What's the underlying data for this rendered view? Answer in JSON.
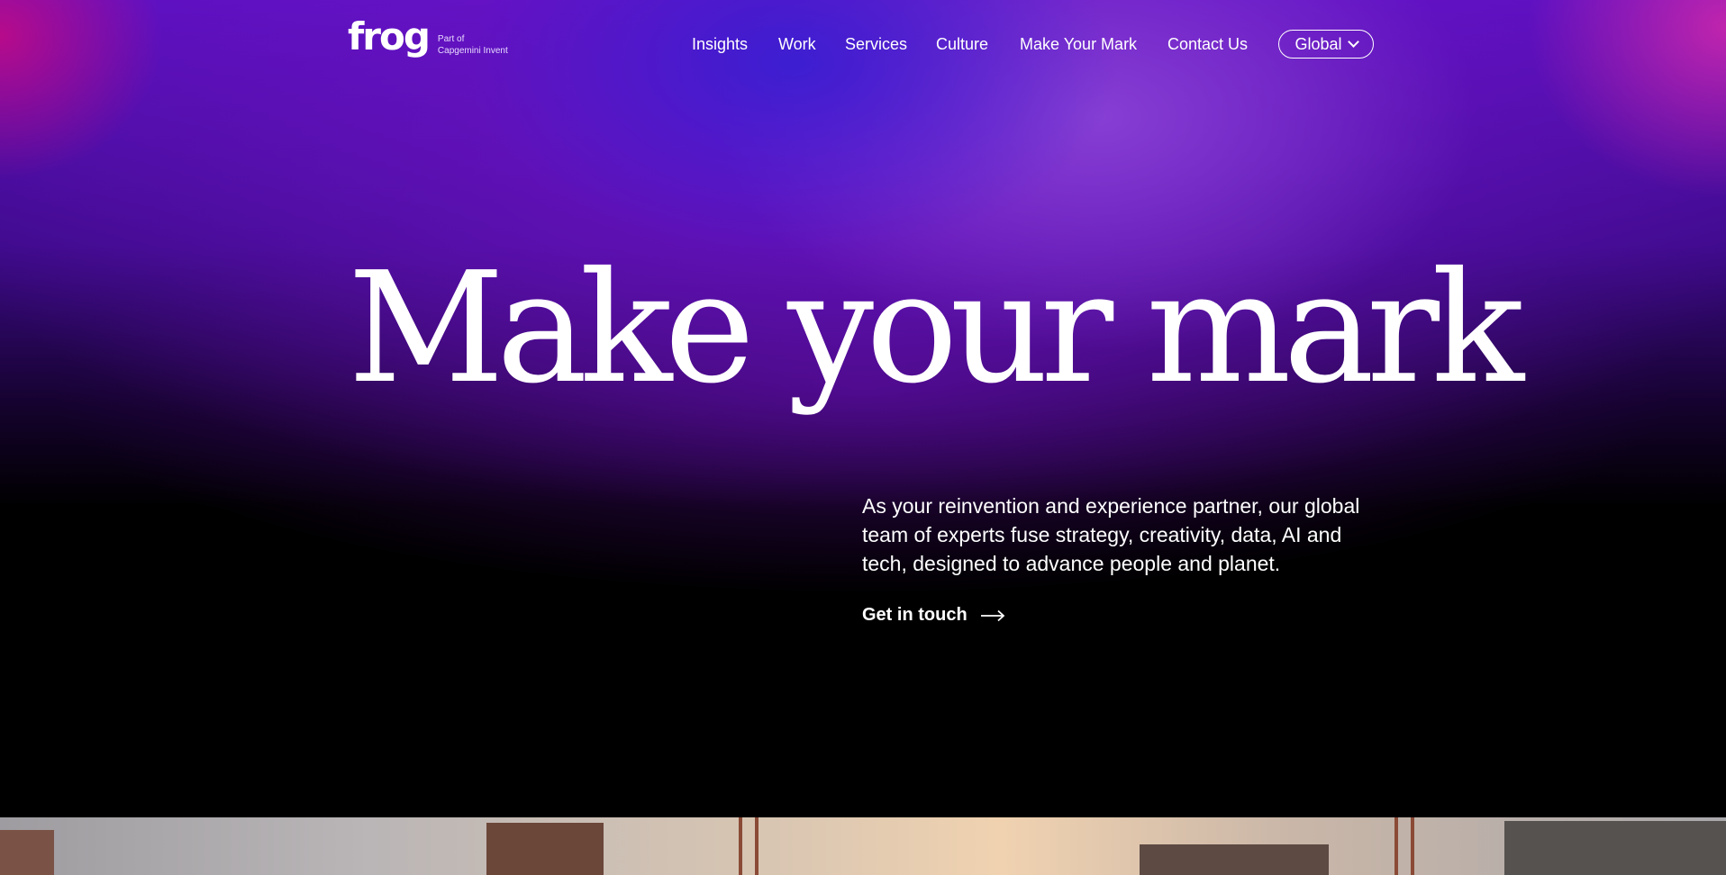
{
  "brand": {
    "wordmark": "frog",
    "tagline_line1": "Part of",
    "tagline_line2": "Capgemini Invent"
  },
  "nav": {
    "items": [
      {
        "label": "Insights"
      },
      {
        "label": "Work"
      },
      {
        "label": "Services"
      },
      {
        "label": "Culture"
      },
      {
        "label": "Make Your Mark"
      },
      {
        "label": "Contact Us"
      }
    ],
    "region_label": "Global",
    "region_icon": "chevron-down-icon"
  },
  "hero": {
    "headline": "Make your mark",
    "intro": "As your reinvention and experience partner, our global team of experts fuse strategy, creativity, data, AI and tech, designed to advance people and planet.",
    "cta_label": "Get in touch",
    "cta_icon": "arrow-right-icon"
  },
  "colors": {
    "background": "#000000",
    "gradient_violet": "#5b10c0",
    "gradient_blue": "#3a1ed2",
    "gradient_magenta": "#c80a82",
    "text": "#ffffff"
  }
}
